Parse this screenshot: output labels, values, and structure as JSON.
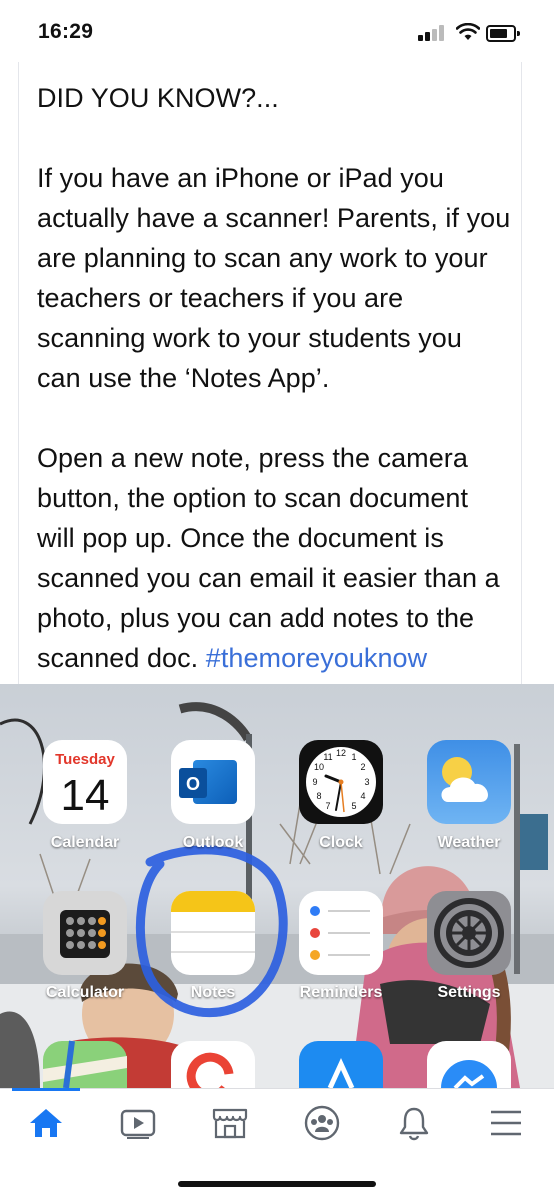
{
  "status_bar": {
    "time": "16:29",
    "icons": [
      "signal-icon",
      "wifi-icon",
      "battery-icon"
    ]
  },
  "post": {
    "heading": "DID YOU KNOW?...",
    "paragraph1": "If you have an iPhone or iPad you actually have a scanner! Parents, if you are planning to scan any work to your teachers or teachers if you are scanning work to your students you can use the ‘Notes App’.",
    "paragraph2": "Open a new note, press the camera button, the option to scan document will pop up. Once the document is scanned you can email it easier than a photo, plus you can add notes to the scanned doc.",
    "hashtag": "#themoreyouknow"
  },
  "photo": {
    "calendar_day": "Tuesday",
    "calendar_date": "14",
    "clock_numbers": [
      "12",
      "1",
      "2",
      "3",
      "4",
      "5",
      "6",
      "7",
      "8",
      "9",
      "10",
      "11"
    ],
    "outlook_letter": "O",
    "apps_row1": [
      "Calendar",
      "Outlook",
      "Clock",
      "Weather"
    ],
    "apps_row2": [
      "Calculator",
      "Notes",
      "Reminders",
      "Settings"
    ],
    "highlight_color": "#2d5fe0"
  },
  "tab_bar": {
    "tabs": [
      "home-icon",
      "video-icon",
      "marketplace-icon",
      "groups-icon",
      "bell-icon",
      "menu-icon"
    ],
    "active_tab": "home-icon",
    "accent": "#1877f2"
  }
}
